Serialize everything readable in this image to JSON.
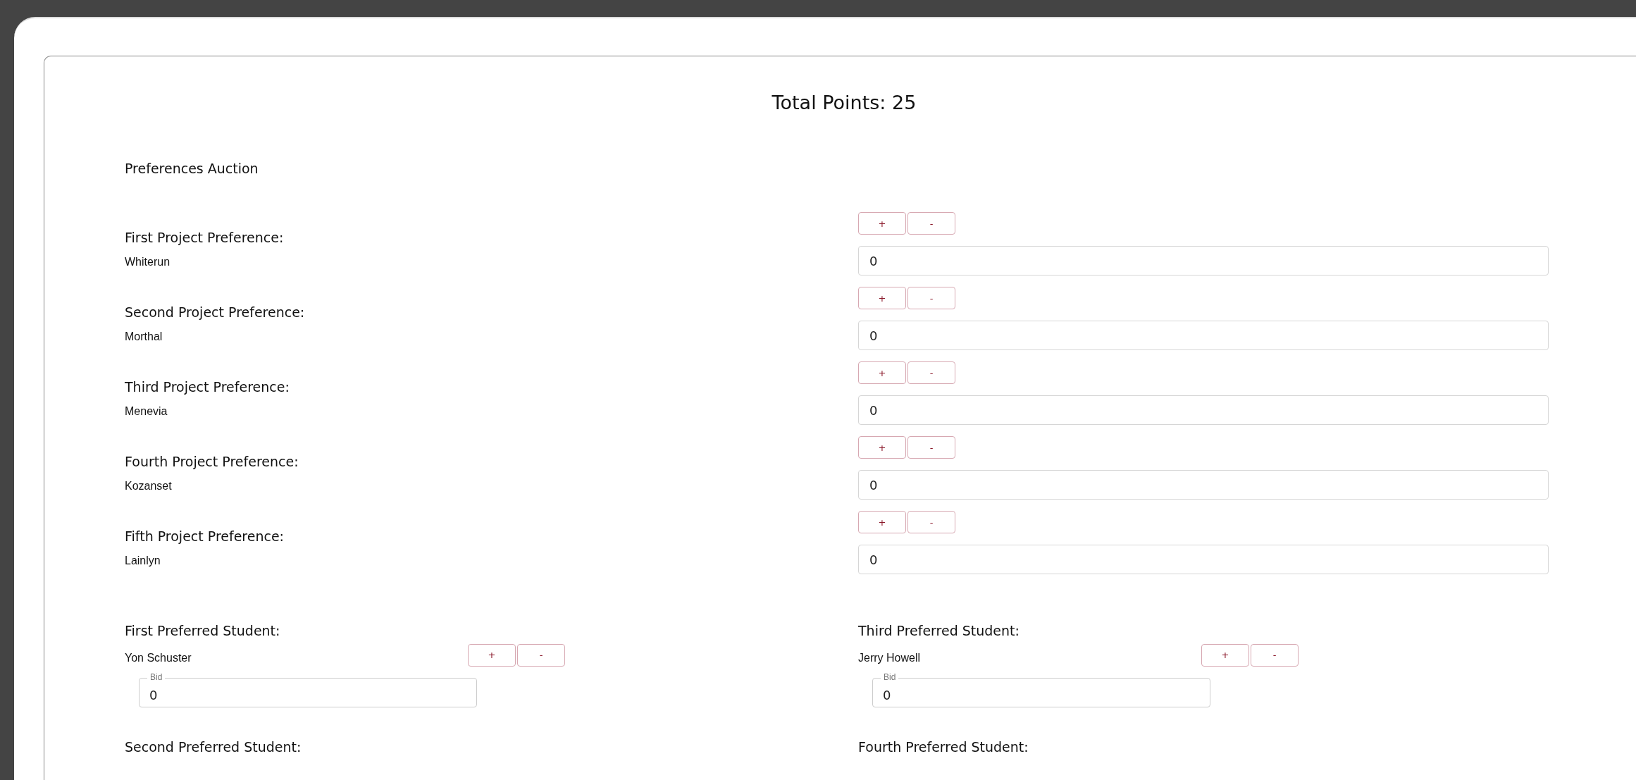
{
  "total_points": "Total Points: 25",
  "section_title": "Preferences Auction",
  "projects": [
    {
      "label": "First Project Preference:",
      "value": "Whiterun",
      "plus": "+",
      "minus": "-",
      "points": "0"
    },
    {
      "label": "Second Project Preference:",
      "value": "Morthal",
      "plus": "+",
      "minus": "-",
      "points": "0"
    },
    {
      "label": "Third Project Preference:",
      "value": "Menevia",
      "plus": "+",
      "minus": "-",
      "points": "0"
    },
    {
      "label": "Fourth Project Preference:",
      "value": "Kozanset",
      "plus": "+",
      "minus": "-",
      "points": "0"
    },
    {
      "label": "Fifth Project Preference:",
      "value": "Lainlyn",
      "plus": "+",
      "minus": "-",
      "points": "0"
    }
  ],
  "students": [
    {
      "label": "First Preferred Student:",
      "name": "Yon Schuster",
      "plus": "+",
      "minus": "-",
      "bid_label": "Bid",
      "bid": "0"
    },
    {
      "label": "Third Preferred Student:",
      "name": "Jerry Howell",
      "plus": "+",
      "minus": "-",
      "bid_label": "Bid",
      "bid": "0"
    },
    {
      "label": "Second Preferred Student:"
    },
    {
      "label": "Fourth Preferred Student:"
    }
  ]
}
